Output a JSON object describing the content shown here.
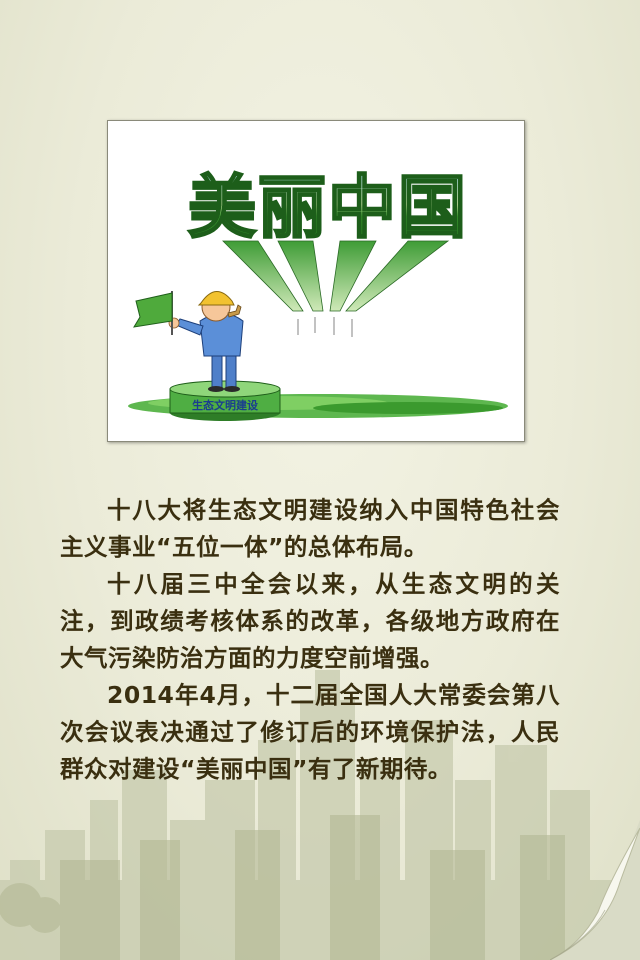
{
  "illustration": {
    "banner_title": "美丽中国",
    "pedestal_label": "生态文明建设"
  },
  "paragraphs": [
    "十八大将生态文明建设纳入中国特色社会主义事业“五位一体”的总体布局。",
    "十八届三中全会以来，从生态文明的关注，到政绩考核体系的改革，各级地方政府在大气污染防治方面的力度空前增强。",
    "2014年4月，十二届全国人大常委会第八次会议表决通过了修订后的环境保护法，人民群众对建设“美丽中国”有了新期待。"
  ],
  "colors": {
    "background": "#ebebd8",
    "text": "#3a2f10",
    "skyline": "#c9ccb0",
    "title_green": "#2f8a2a"
  }
}
